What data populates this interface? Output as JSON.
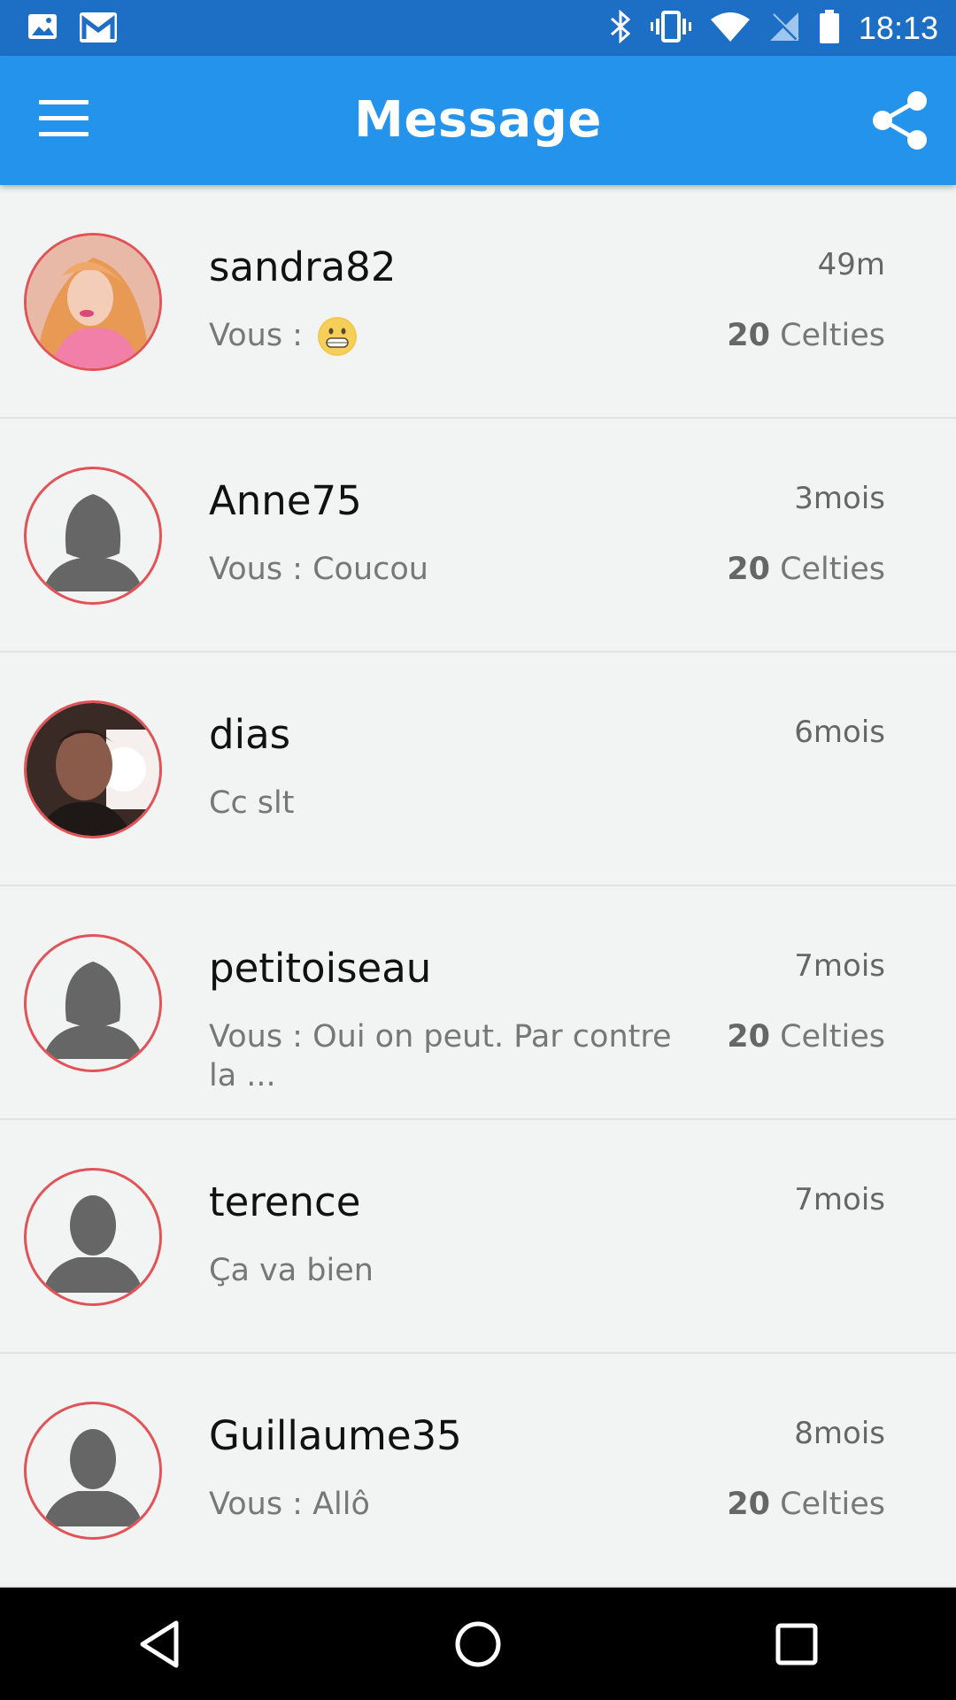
{
  "status_bar": {
    "time": "18:13",
    "icons": [
      "image-icon",
      "gmail-icon",
      "bluetooth-icon",
      "vibrate-icon",
      "wifi-icon",
      "no-sim-icon",
      "battery-icon"
    ]
  },
  "app_bar": {
    "title": "Message",
    "menu_icon": "hamburger-icon",
    "share_icon": "share-icon"
  },
  "conversations": [
    {
      "name": "sandra82",
      "time": "49m",
      "preview": "Vous : ",
      "emoji": "grinning-emoji",
      "credit_value": "20",
      "credit_unit": "Celties",
      "avatar": "photo"
    },
    {
      "name": "Anne75",
      "time": "3mois",
      "preview": "Vous : Coucou",
      "credit_value": "20",
      "credit_unit": "Celties",
      "avatar": "female-silhouette"
    },
    {
      "name": "dias",
      "time": "6mois",
      "preview": "Cc slt",
      "credit_value": "",
      "credit_unit": "",
      "avatar": "photo"
    },
    {
      "name": "petitoiseau",
      "time": "7mois",
      "preview": "Vous : Oui on peut. Par contre la ...",
      "credit_value": "20",
      "credit_unit": "Celties",
      "avatar": "female-silhouette"
    },
    {
      "name": "terence",
      "time": "7mois",
      "preview": "Ça va bien",
      "credit_value": "",
      "credit_unit": "",
      "avatar": "male-silhouette"
    },
    {
      "name": "Guillaume35",
      "time": "8mois",
      "preview": "Vous : Allô",
      "credit_value": "20",
      "credit_unit": "Celties",
      "avatar": "male-silhouette"
    }
  ],
  "colors": {
    "status_bar": "#1c6fc4",
    "app_bar": "#2393ec",
    "avatar_border": "#e05357",
    "background": "#f2f3f3"
  },
  "nav_bar": [
    "back-icon",
    "home-icon",
    "recents-icon"
  ]
}
